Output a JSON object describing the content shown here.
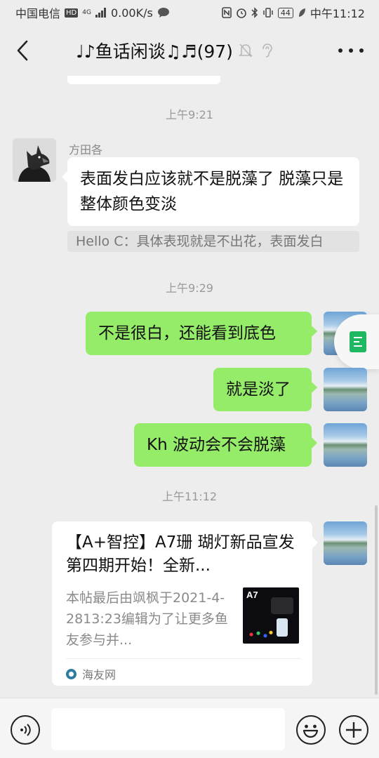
{
  "status_bar": {
    "carrier": "中国电信",
    "hd_badge": "HD",
    "network": "4G",
    "speed": "0.00K/s",
    "battery": "44",
    "time": "中午11:12"
  },
  "nav": {
    "title": "♩♪鱼话闲谈♫♬(97)",
    "icons": [
      "back-icon",
      "mute-bell-icon",
      "ear-icon",
      "more-icon"
    ]
  },
  "chat": {
    "messages": [
      {
        "type": "time",
        "text": "上午9:21"
      },
      {
        "type": "incoming",
        "sender": "方田各",
        "text": "表面发白应该就不是脱藻了 脱藻只是整体颜色变淡",
        "quote": "Hello C：具体表现就是不出花，表面发白"
      },
      {
        "type": "time",
        "text": "上午9:29"
      },
      {
        "type": "outgoing",
        "text": "不是很白，还能看到底色"
      },
      {
        "type": "outgoing",
        "text": "就是淡了"
      },
      {
        "type": "outgoing",
        "text": "Kh 波动会不会脱藻"
      },
      {
        "type": "time",
        "text": "上午11:12"
      },
      {
        "type": "outgoing_link",
        "title": "【A+智控】A7珊 瑚灯新品宣发  第四期开始！全新...",
        "desc": "本帖最后由飒枫于2021-4-2813:23编辑为了让更多鱼友参与并...",
        "thumb_label": "A7",
        "source": "海友网"
      }
    ]
  },
  "input_bar": {
    "placeholder": "",
    "icons": [
      "voice-icon",
      "emoji-icon",
      "plus-icon"
    ]
  }
}
